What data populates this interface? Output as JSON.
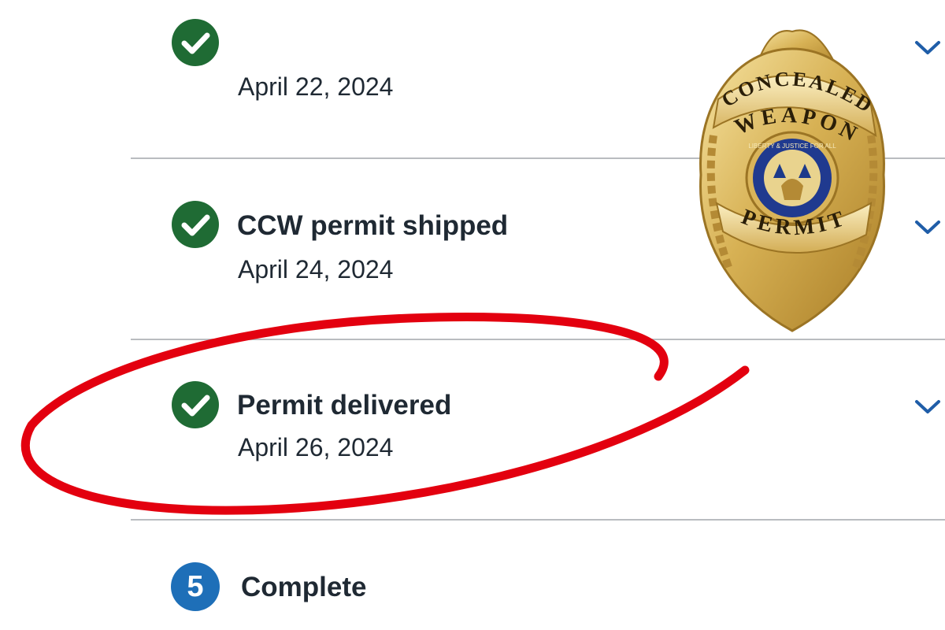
{
  "tracker": {
    "steps": [
      {
        "status": "complete",
        "icon": "check-circle-icon",
        "title": "",
        "date": "April 22, 2024"
      },
      {
        "status": "complete",
        "icon": "check-circle-icon",
        "title": "CCW permit shipped",
        "date": "April 24, 2024"
      },
      {
        "status": "complete",
        "icon": "check-circle-icon",
        "title": "Permit delivered",
        "date": "April 26, 2024"
      },
      {
        "status": "pending",
        "icon": "step-number-icon",
        "number": "5",
        "title": "Complete"
      }
    ]
  },
  "badge": {
    "top_text": "CONCEALED",
    "middle_text": "WEAPON",
    "bottom_text": "PERMIT",
    "seal_text": "LIBERTY & JUSTICE FOR ALL"
  },
  "colors": {
    "check_green": "#1f6b34",
    "step_blue": "#1e6fb8",
    "chevron_blue": "#1f5da8",
    "annotation_red": "#e3000f",
    "badge_gold": "#d9b45a"
  }
}
